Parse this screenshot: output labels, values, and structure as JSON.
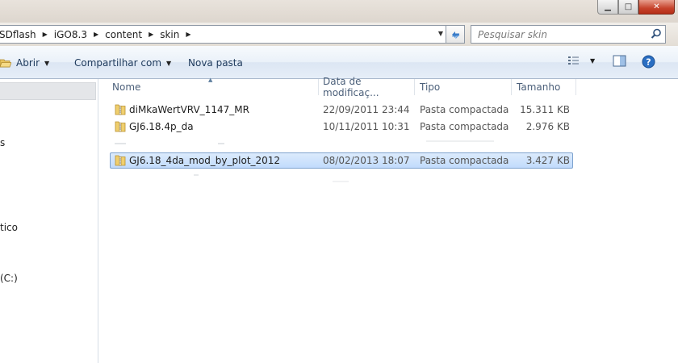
{
  "window": {
    "min_glyph": "▁",
    "max_glyph": "□",
    "close_glyph": "✕"
  },
  "address": {
    "crumbs": [
      "SDflash",
      "iGO8.3",
      "content",
      "skin"
    ],
    "separator_glyph": "▶"
  },
  "search": {
    "placeholder": "Pesquisar skin"
  },
  "toolbar": {
    "open_label": "Abrir",
    "share_label": "Compartilhar com",
    "new_folder_label": "Nova pasta"
  },
  "nav_pane": {
    "items": [
      "s",
      "tico",
      "(C:)"
    ]
  },
  "columns": {
    "name": "Nome",
    "date": "Data de modificaç...",
    "type": "Tipo",
    "size": "Tamanho"
  },
  "files": [
    {
      "name": "diMkaWertVRV_1147_MR",
      "date": "22/09/2011 23:44",
      "type": "Pasta compactada",
      "size": "15.311 KB"
    },
    {
      "name": "GJ6.18.4p_da",
      "date": "10/11/2011 10:31",
      "type": "Pasta compactada",
      "size": "2.976 KB"
    },
    {
      "name": "GJ6.18_4da_mod_by_plot_2012",
      "date": "08/02/2013 18:07",
      "type": "Pasta compactada",
      "size": "3.427 KB"
    }
  ],
  "colors": {
    "selection_fill": "#c7defc",
    "selection_border": "#7da2ce",
    "toolbar_text": "#1e3a5c",
    "header_text": "#4c607a"
  },
  "icons": {
    "folder_zip": "compressed-folder-icon",
    "search": "search-icon",
    "refresh": "refresh-icon",
    "views": "view-options-icon",
    "preview": "preview-pane-icon",
    "help": "help-icon"
  }
}
